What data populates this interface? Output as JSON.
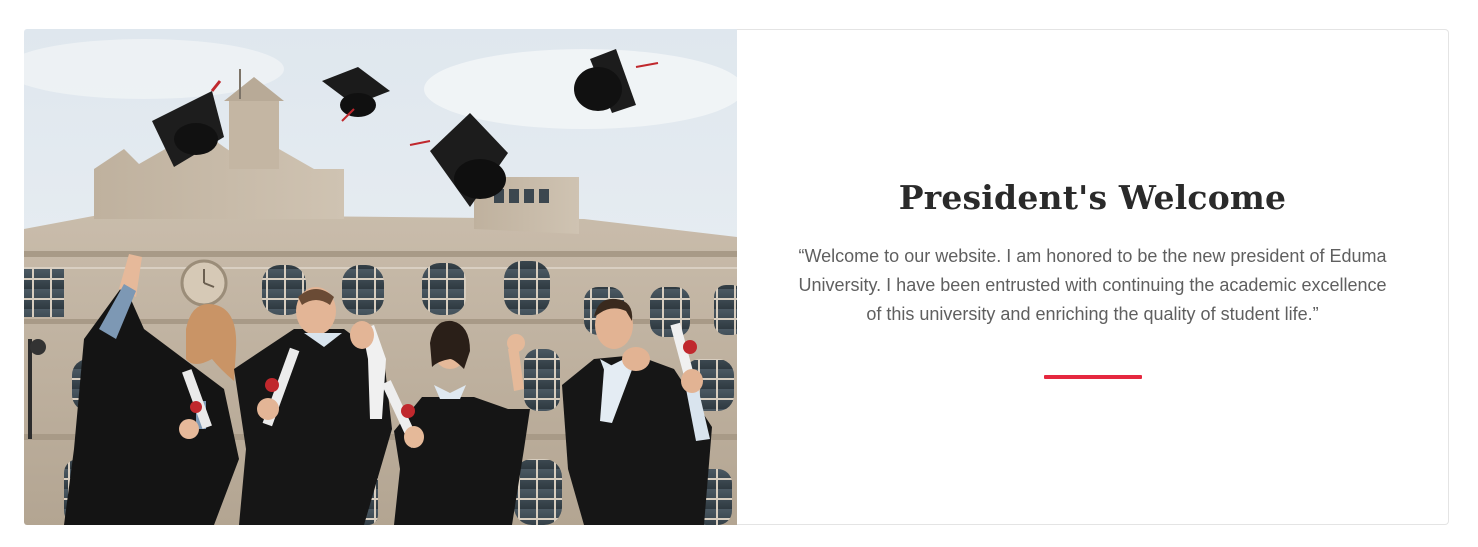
{
  "welcome": {
    "title": "President's Welcome",
    "quote": "“Welcome to our website. I am honored to be the new president of Eduma University. I have been entrusted with continuing the academic excellence of this university and enriching the quality of student life.”",
    "accent_color": "#e5283f"
  },
  "photo": {
    "subject": "graduates-throwing-caps"
  }
}
